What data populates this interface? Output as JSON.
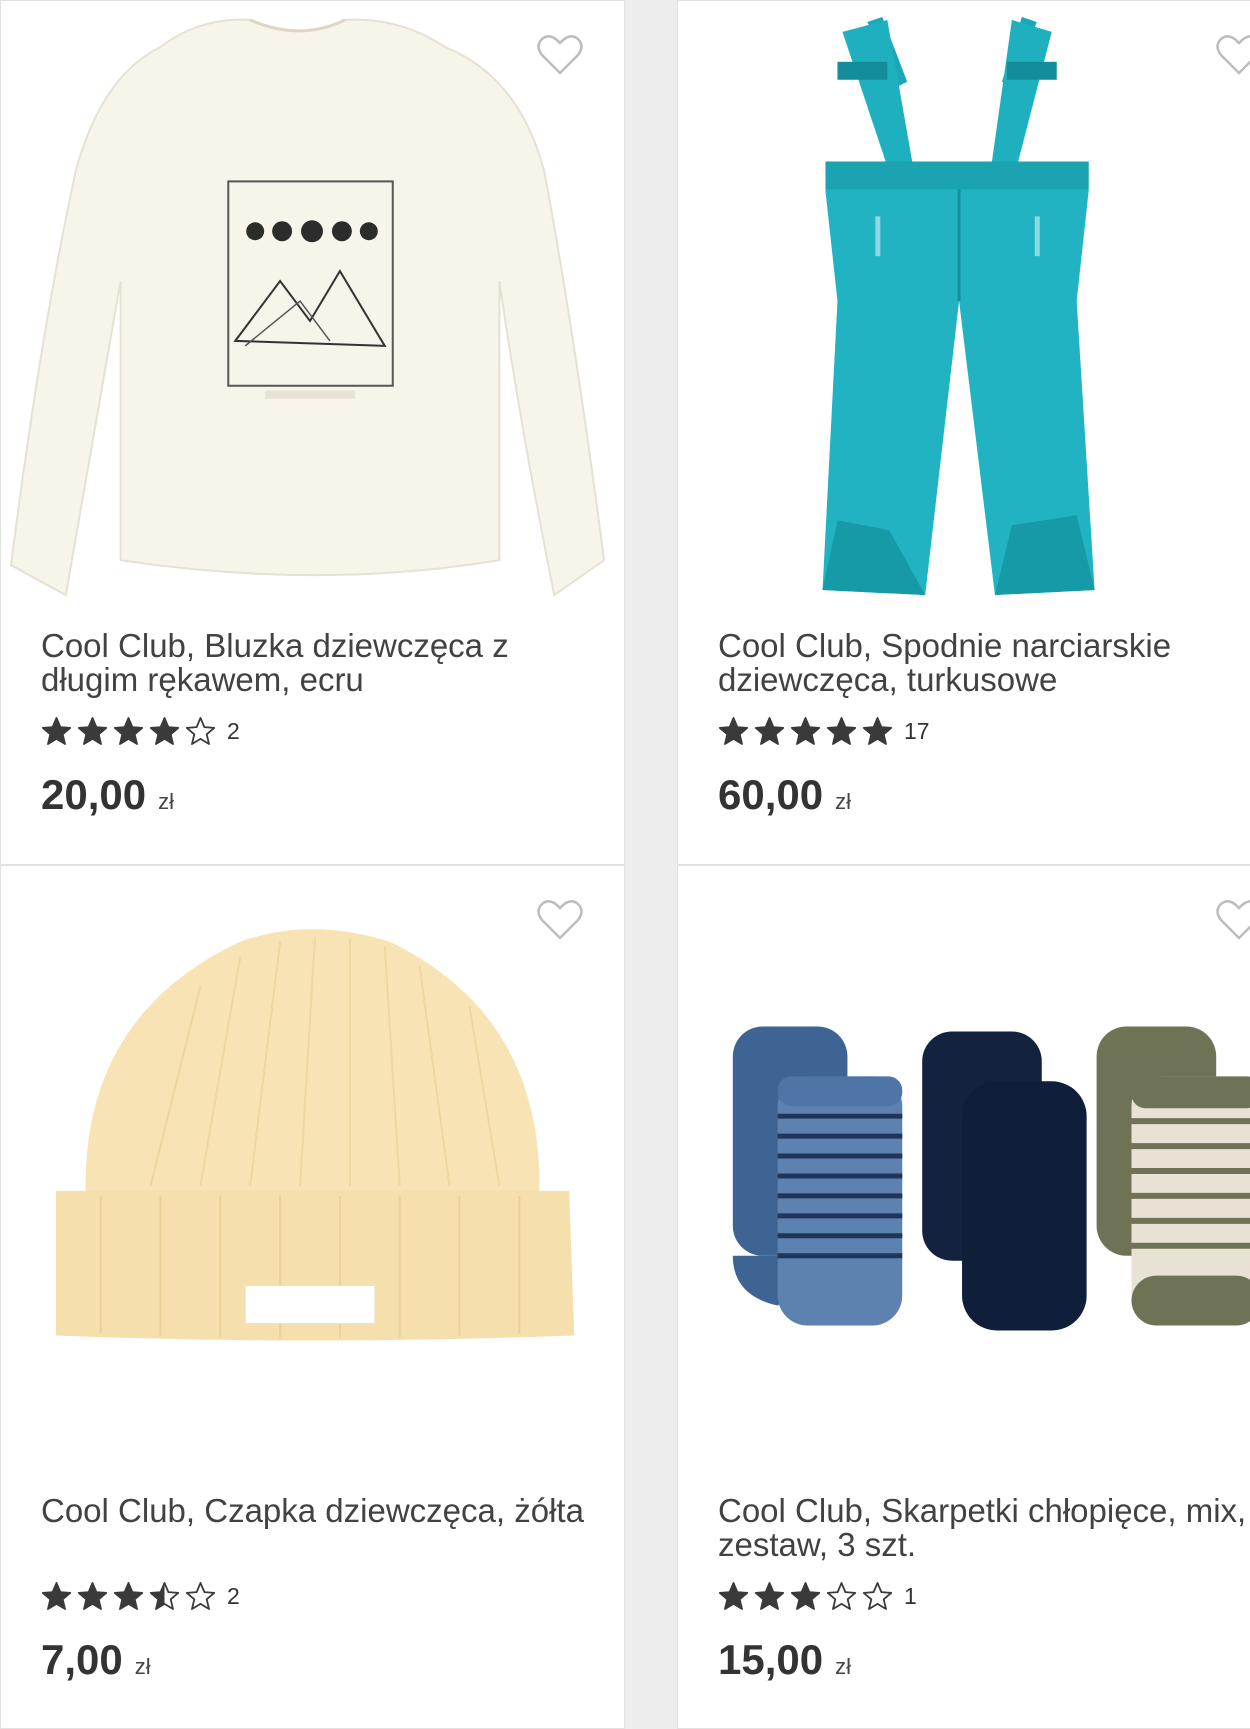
{
  "products": [
    {
      "title": "Cool Club, Bluzka dziewczęca z długim rękawem, ecru",
      "rating_count": "2",
      "stars": [
        "full",
        "full",
        "full",
        "full",
        "empty"
      ],
      "price": "20,00",
      "currency": "zł",
      "image": "ecru-long-sleeve-top-icon"
    },
    {
      "title": "Cool Club, Spodnie narciarskie dziewczęca, turkusowe",
      "rating_count": "17",
      "stars": [
        "full",
        "full",
        "full",
        "full",
        "full"
      ],
      "price": "60,00",
      "currency": "zł",
      "image": "turquoise-ski-pants-icon"
    },
    {
      "title": "Cool Club, Czapka dziewczęca, żółta",
      "rating_count": "2",
      "stars": [
        "full",
        "full",
        "full",
        "half",
        "empty"
      ],
      "price": "7,00",
      "currency": "zł",
      "image": "yellow-beanie-icon"
    },
    {
      "title": "Cool Club, Skarpetki chłopięce, mix, zestaw, 3 szt.",
      "rating_count": "1",
      "stars": [
        "full",
        "full",
        "full",
        "empty",
        "empty"
      ],
      "price": "15,00",
      "currency": "zł",
      "image": "socks-set-icon"
    }
  ],
  "colors": {
    "star": "#3a3a3a",
    "heart": "#bdbdbd",
    "card_border": "#e2e2e2"
  }
}
